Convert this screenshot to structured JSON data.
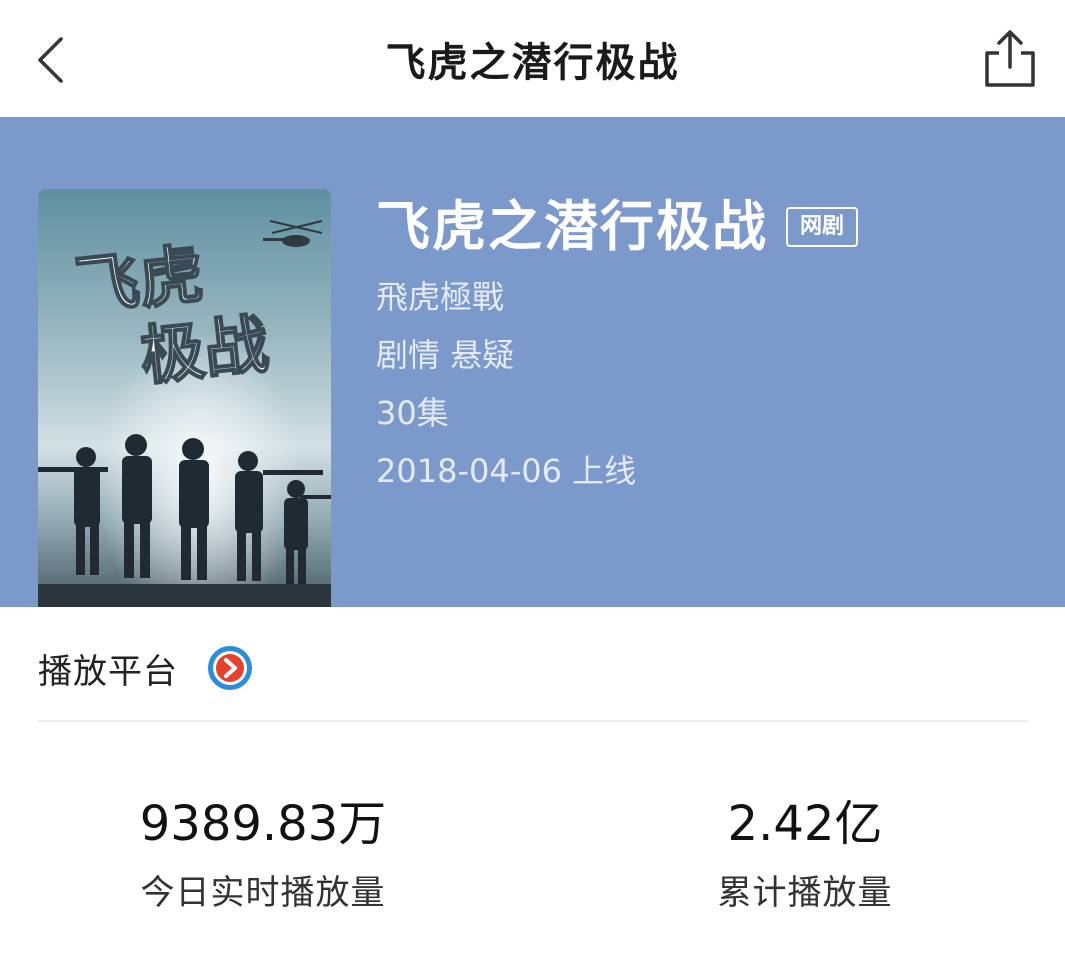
{
  "nav": {
    "title": "飞虎之潜行极战"
  },
  "drama": {
    "title": "飞虎之潜行极战",
    "type_tag": "网剧",
    "alt_title": "飛虎極戰",
    "genres": "剧情 悬疑",
    "episodes": "30集",
    "release": "2018-04-06 上线",
    "poster_text_line1": "飞虎",
    "poster_text_line2": "极战"
  },
  "platform": {
    "label": "播放平台",
    "icon": "youku-play-icon"
  },
  "stats": {
    "today_value": "9389.83万",
    "today_label": "今日实时播放量",
    "total_value": "2.42亿",
    "total_label": "累计播放量"
  },
  "colors": {
    "header_bg": "#7c99cc",
    "platform_red": "#e8402f",
    "platform_blue": "#2a8ce0"
  }
}
